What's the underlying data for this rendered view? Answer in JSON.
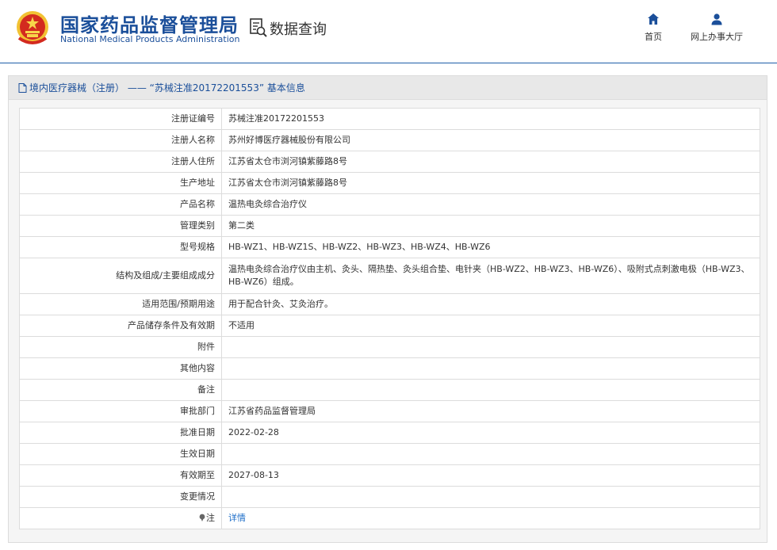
{
  "header": {
    "brand_cn": "国家药品监督管理局",
    "brand_en": "National Medical Products Administration",
    "query_title": "数据查询",
    "nav": {
      "home_label": "首页",
      "hall_label": "网上办事大厅"
    }
  },
  "panel": {
    "title": "境内医疗器械（注册） —— “苏械注准20172201553” 基本信息"
  },
  "rows": [
    {
      "label": "注册证编号",
      "value": "苏械注准20172201553"
    },
    {
      "label": "注册人名称",
      "value": "苏州好博医疗器械股份有限公司"
    },
    {
      "label": "注册人住所",
      "value": "江苏省太仓市浏河镇紫藤路8号"
    },
    {
      "label": "生产地址",
      "value": "江苏省太仓市浏河镇紫藤路8号"
    },
    {
      "label": "产品名称",
      "value": "温热电灸综合治疗仪"
    },
    {
      "label": "管理类别",
      "value": "第二类"
    },
    {
      "label": "型号规格",
      "value": "HB-WZ1、HB-WZ1S、HB-WZ2、HB-WZ3、HB-WZ4、HB-WZ6"
    },
    {
      "label": "结构及组成/主要组成成分",
      "value": "温热电灸综合治疗仪由主机、灸头、隔热垫、灸头组合垫、电针夹（HB-WZ2、HB-WZ3、HB-WZ6）、吸附式点刺激电极（HB-WZ3、HB-WZ6）组成。"
    },
    {
      "label": "适用范围/预期用途",
      "value": "用于配合针灸、艾灸治疗。"
    },
    {
      "label": "产品储存条件及有效期",
      "value": "不适用"
    },
    {
      "label": "附件",
      "value": ""
    },
    {
      "label": "其他内容",
      "value": ""
    },
    {
      "label": "备注",
      "value": ""
    },
    {
      "label": "审批部门",
      "value": "江苏省药品监督管理局"
    },
    {
      "label": "批准日期",
      "value": "2022-02-28"
    },
    {
      "label": "生效日期",
      "value": ""
    },
    {
      "label": "有效期至",
      "value": "2027-08-13"
    },
    {
      "label": "变更情况",
      "value": ""
    },
    {
      "label": "注",
      "value": "详情"
    }
  ],
  "colors": {
    "brand_blue": "#1b4f9a",
    "link_blue": "#1e6ec8",
    "border": "#dcdcdc",
    "title_bar": "#e8e8e8"
  }
}
